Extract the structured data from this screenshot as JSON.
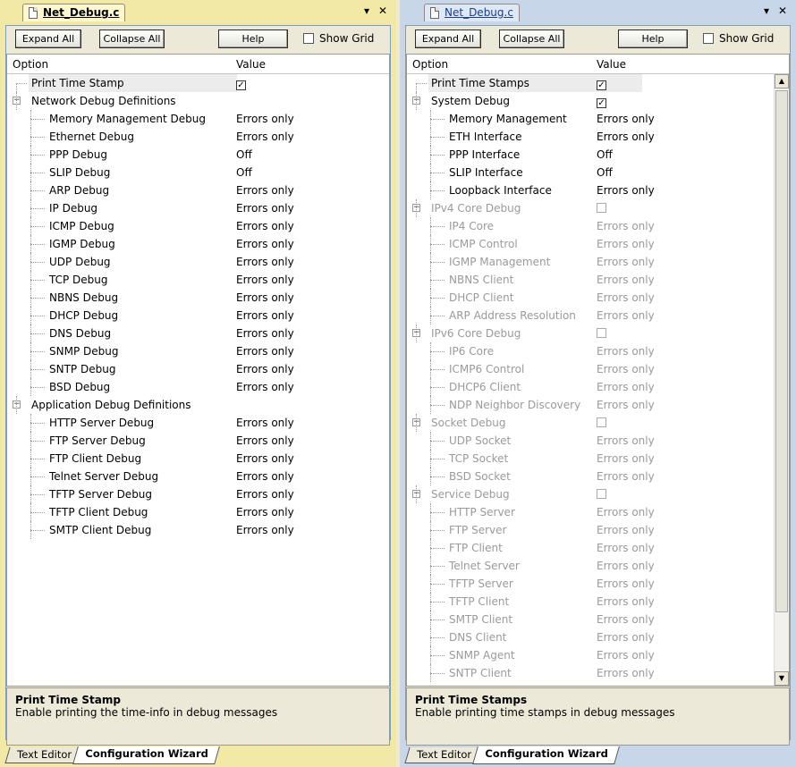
{
  "left": {
    "tab_title": "Net_Debug.c",
    "toolbar": {
      "expand": "Expand All",
      "collapse": "Collapse All",
      "help": "Help",
      "grid": "Show Grid"
    },
    "columns": {
      "option": "Option",
      "value": "Value"
    },
    "desc": {
      "title": "Print Time Stamp",
      "text": "Enable printing the time-info in debug messages"
    },
    "bottom_tabs": [
      "Text Editor",
      "Configuration Wizard"
    ],
    "rows": [
      {
        "l": 0,
        "o": "Print Time Stamp",
        "v": "",
        "chk": true,
        "sel": true
      },
      {
        "l": 0,
        "o": "Network Debug Definitions",
        "v": "",
        "exp": true
      },
      {
        "l": 1,
        "o": "Memory Management Debug",
        "v": "Errors only"
      },
      {
        "l": 1,
        "o": "Ethernet Debug",
        "v": "Errors only"
      },
      {
        "l": 1,
        "o": "PPP Debug",
        "v": "Off"
      },
      {
        "l": 1,
        "o": "SLIP Debug",
        "v": "Off"
      },
      {
        "l": 1,
        "o": "ARP Debug",
        "v": "Errors only"
      },
      {
        "l": 1,
        "o": "IP Debug",
        "v": "Errors only"
      },
      {
        "l": 1,
        "o": "ICMP Debug",
        "v": "Errors only"
      },
      {
        "l": 1,
        "o": "IGMP Debug",
        "v": "Errors only"
      },
      {
        "l": 1,
        "o": "UDP Debug",
        "v": "Errors only"
      },
      {
        "l": 1,
        "o": "TCP Debug",
        "v": "Errors only"
      },
      {
        "l": 1,
        "o": "NBNS Debug",
        "v": "Errors only"
      },
      {
        "l": 1,
        "o": "DHCP Debug",
        "v": "Errors only"
      },
      {
        "l": 1,
        "o": "DNS Debug",
        "v": "Errors only"
      },
      {
        "l": 1,
        "o": "SNMP Debug",
        "v": "Errors only"
      },
      {
        "l": 1,
        "o": "SNTP Debug",
        "v": "Errors only"
      },
      {
        "l": 1,
        "o": "BSD Debug",
        "v": "Errors only"
      },
      {
        "l": 0,
        "o": "Application Debug Definitions",
        "v": "",
        "exp": true
      },
      {
        "l": 1,
        "o": "HTTP Server Debug",
        "v": "Errors only"
      },
      {
        "l": 1,
        "o": "FTP Server Debug",
        "v": "Errors only"
      },
      {
        "l": 1,
        "o": "FTP Client Debug",
        "v": "Errors only"
      },
      {
        "l": 1,
        "o": "Telnet Server Debug",
        "v": "Errors only"
      },
      {
        "l": 1,
        "o": "TFTP Server Debug",
        "v": "Errors only"
      },
      {
        "l": 1,
        "o": "TFTP Client Debug",
        "v": "Errors only"
      },
      {
        "l": 1,
        "o": "SMTP Client Debug",
        "v": "Errors only"
      }
    ]
  },
  "right": {
    "tab_title": "Net_Debug.c",
    "toolbar": {
      "expand": "Expand All",
      "collapse": "Collapse All",
      "help": "Help",
      "grid": "Show Grid"
    },
    "columns": {
      "option": "Option",
      "value": "Value"
    },
    "desc": {
      "title": "Print Time Stamps",
      "text": "Enable printing time stamps in debug messages"
    },
    "bottom_tabs": [
      "Text Editor",
      "Configuration Wizard"
    ],
    "rows": [
      {
        "l": 0,
        "o": "Print Time Stamps",
        "v": "",
        "chk": true,
        "sel": true
      },
      {
        "l": 0,
        "o": "System Debug",
        "v": "",
        "exp": true,
        "chk": true
      },
      {
        "l": 1,
        "o": "Memory Management",
        "v": "Errors only"
      },
      {
        "l": 1,
        "o": "ETH Interface",
        "v": "Errors only"
      },
      {
        "l": 1,
        "o": "PPP Interface",
        "v": "Off"
      },
      {
        "l": 1,
        "o": "SLIP Interface",
        "v": "Off"
      },
      {
        "l": 1,
        "o": "Loopback Interface",
        "v": "Errors only"
      },
      {
        "l": 0,
        "o": "IPv4 Core Debug",
        "v": "",
        "exp": true,
        "chk": false,
        "dis": true
      },
      {
        "l": 1,
        "o": "IP4 Core",
        "v": "Errors only",
        "dis": true
      },
      {
        "l": 1,
        "o": "ICMP Control",
        "v": "Errors only",
        "dis": true
      },
      {
        "l": 1,
        "o": "IGMP Management",
        "v": "Errors only",
        "dis": true
      },
      {
        "l": 1,
        "o": "NBNS Client",
        "v": "Errors only",
        "dis": true
      },
      {
        "l": 1,
        "o": "DHCP Client",
        "v": "Errors only",
        "dis": true
      },
      {
        "l": 1,
        "o": "ARP Address Resolution",
        "v": "Errors only",
        "dis": true
      },
      {
        "l": 0,
        "o": "IPv6 Core Debug",
        "v": "",
        "exp": true,
        "chk": false,
        "dis": true
      },
      {
        "l": 1,
        "o": "IP6 Core",
        "v": "Errors only",
        "dis": true
      },
      {
        "l": 1,
        "o": "ICMP6 Control",
        "v": "Errors only",
        "dis": true
      },
      {
        "l": 1,
        "o": "DHCP6 Client",
        "v": "Errors only",
        "dis": true
      },
      {
        "l": 1,
        "o": "NDP Neighbor Discovery",
        "v": "Errors only",
        "dis": true
      },
      {
        "l": 0,
        "o": "Socket Debug",
        "v": "",
        "exp": true,
        "chk": false,
        "dis": true
      },
      {
        "l": 1,
        "o": "UDP Socket",
        "v": "Errors only",
        "dis": true
      },
      {
        "l": 1,
        "o": "TCP Socket",
        "v": "Errors only",
        "dis": true
      },
      {
        "l": 1,
        "o": "BSD Socket",
        "v": "Errors only",
        "dis": true
      },
      {
        "l": 0,
        "o": "Service Debug",
        "v": "",
        "exp": true,
        "chk": false,
        "dis": true
      },
      {
        "l": 1,
        "o": "HTTP Server",
        "v": "Errors only",
        "dis": true
      },
      {
        "l": 1,
        "o": "FTP Server",
        "v": "Errors only",
        "dis": true
      },
      {
        "l": 1,
        "o": "FTP Client",
        "v": "Errors only",
        "dis": true
      },
      {
        "l": 1,
        "o": "Telnet Server",
        "v": "Errors only",
        "dis": true
      },
      {
        "l": 1,
        "o": "TFTP Server",
        "v": "Errors only",
        "dis": true
      },
      {
        "l": 1,
        "o": "TFTP Client",
        "v": "Errors only",
        "dis": true
      },
      {
        "l": 1,
        "o": "SMTP Client",
        "v": "Errors only",
        "dis": true
      },
      {
        "l": 1,
        "o": "DNS Client",
        "v": "Errors only",
        "dis": true
      },
      {
        "l": 1,
        "o": "SNMP Agent",
        "v": "Errors only",
        "dis": true
      },
      {
        "l": 1,
        "o": "SNTP Client",
        "v": "Errors only",
        "dis": true
      }
    ]
  }
}
